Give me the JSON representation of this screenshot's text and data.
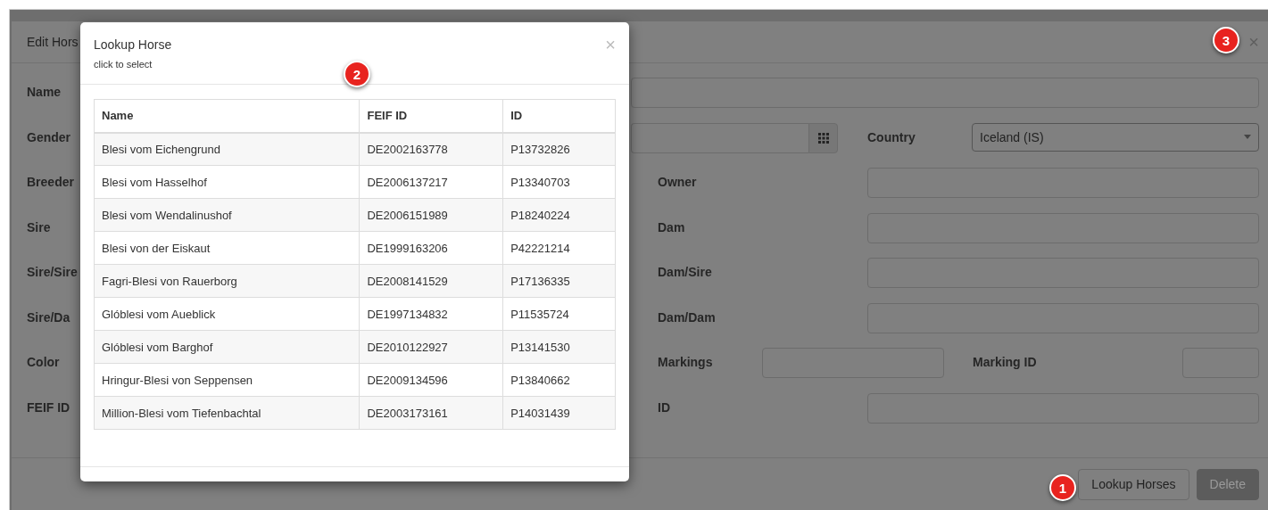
{
  "edit_dialog": {
    "title": "Edit Hors",
    "close": "×",
    "form": [
      {
        "kind": "wide",
        "label": "Name"
      },
      {
        "kind": "gender",
        "label": "Gender",
        "country_label": "Country",
        "country_value": "Iceland (IS)"
      },
      {
        "kind": "pair",
        "label": "Breeder",
        "right_label": "Owner"
      },
      {
        "kind": "pair",
        "label": "Sire",
        "right_label": "Dam"
      },
      {
        "kind": "pair",
        "label": "Sire/Sire",
        "right_label": "Dam/Sire"
      },
      {
        "kind": "pair",
        "label": "Sire/Da",
        "right_label": "Dam/Dam"
      },
      {
        "kind": "markings",
        "label": "Color",
        "right_label": "Markings",
        "extra_label": "Marking ID"
      },
      {
        "kind": "pair",
        "label": "FEIF ID",
        "right_label": "ID"
      }
    ],
    "buttons": [
      {
        "label": "Lookup Horses",
        "kind": "default"
      },
      {
        "label": "Delete",
        "kind": "disabled"
      }
    ]
  },
  "lookup_dialog": {
    "title": "Lookup Horse",
    "subtitle": "click to select",
    "close": "×",
    "table": {
      "columns": [
        "Name",
        "FEIF ID",
        "ID"
      ],
      "rows": [
        [
          "Blesi vom Eichengrund",
          "DE2002163778",
          "P13732826"
        ],
        [
          "Blesi vom Hasselhof",
          "DE2006137217",
          "P13340703"
        ],
        [
          "Blesi vom Wendalinushof",
          "DE2006151989",
          "P18240224"
        ],
        [
          "Blesi von der Eiskaut",
          "DE1999163206",
          "P42221214"
        ],
        [
          "Fagri-Blesi von Rauerborg",
          "DE2008141529",
          "P17136335"
        ],
        [
          "Glóblesi vom Aueblick",
          "DE1997134832",
          "P11535724"
        ],
        [
          "Glóblesi vom Barghof",
          "DE2010122927",
          "P13141530"
        ],
        [
          "Hringur-Blesi von Seppensen",
          "DE2009134596",
          "P13840662"
        ],
        [
          "Million-Blesi vom Tiefenbachtal",
          "DE2003173161",
          "P14031439"
        ]
      ]
    }
  },
  "callouts": [
    "1",
    "2",
    "3"
  ]
}
